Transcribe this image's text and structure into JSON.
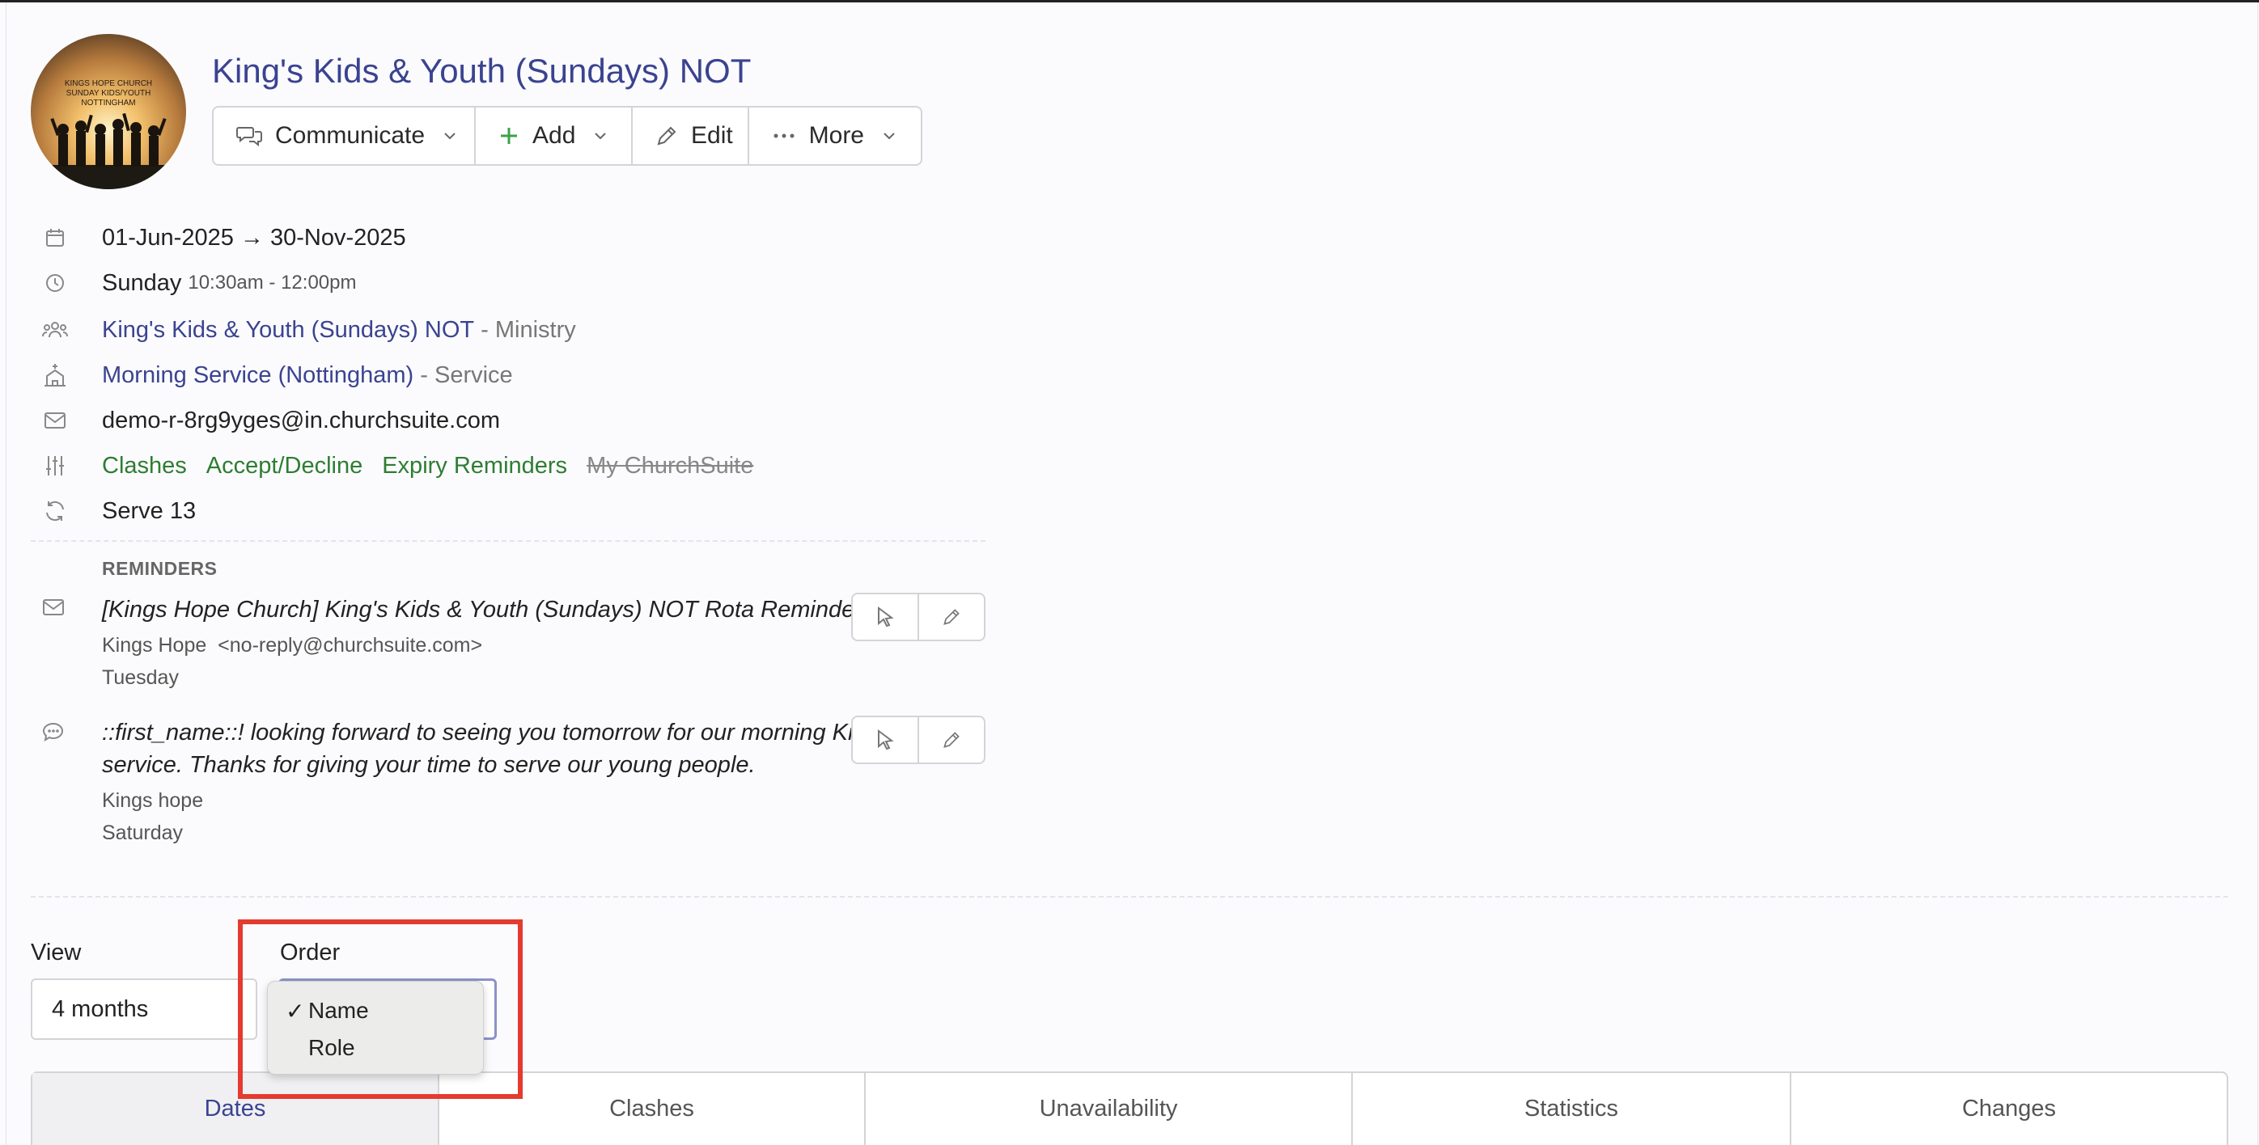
{
  "event": {
    "title": "King's Kids & Youth (Sundays) NOT",
    "logo_text": [
      "KINGS HOPE CHURCH",
      "SUNDAY KIDS/YOUTH",
      "NOTTINGHAM"
    ]
  },
  "toolbar": {
    "communicate_label": "Communicate",
    "add_label": "Add",
    "edit_label": "Edit",
    "more_label": "More"
  },
  "details": {
    "date_range": "01-Jun-2025 → 30-Nov-2025",
    "day": "Sunday",
    "time": "10:30am - 12:00pm",
    "ministry_name": "King's Kids & Youth (Sundays) NOT",
    "ministry_suffix": " - Ministry",
    "service_name": "Morning Service (Nottingham)",
    "service_suffix": " - Service",
    "email": "demo-r-8rg9yges@in.churchsuite.com",
    "settings": {
      "clashes": "Clashes",
      "accept_decline": "Accept/Decline",
      "expiry_reminders": "Expiry Reminders",
      "my_churchsuite": "My ChurchSuite"
    },
    "serve": "Serve 13"
  },
  "reminders": {
    "heading": "REMINDERS",
    "items": [
      {
        "message": "[Kings Hope Church] King's Kids & Youth (Sundays) NOT Rota Reminder",
        "sender": "Kings Hope",
        "sender_email": "<no-reply@churchsuite.com>",
        "day": "Tuesday"
      },
      {
        "message_line1": "::first_name::! looking forward to seeing you tomorrow for our morning Kids",
        "message_line2": "service. Thanks for giving your time to serve our young people.",
        "sender": "Kings hope",
        "day": "Saturday"
      }
    ]
  },
  "filters": {
    "view_label": "View",
    "view_value": "4 months",
    "order_label": "Order",
    "order_options": [
      {
        "label": "Name",
        "checked": "✓"
      },
      {
        "label": "Role",
        "checked": ""
      }
    ]
  },
  "tabs": [
    "Dates",
    "Clashes",
    "Unavailability",
    "Statistics",
    "Changes"
  ],
  "colors": {
    "link": "#3a4390",
    "green": "#2e7d32",
    "highlight": "#e53a2f"
  }
}
